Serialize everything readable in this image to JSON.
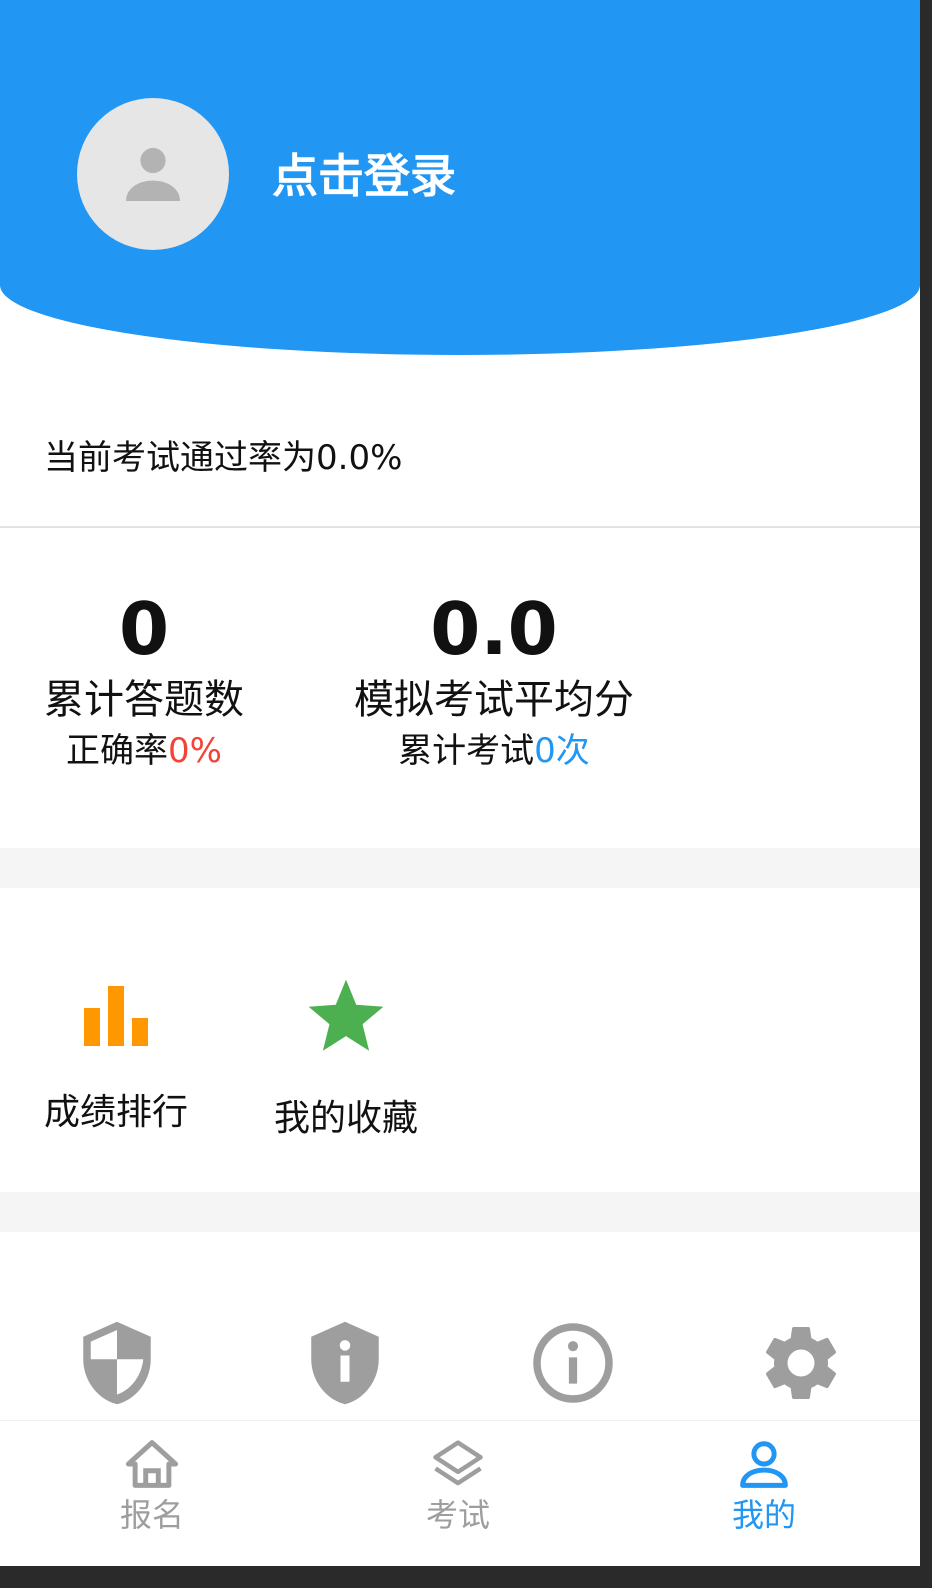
{
  "header": {
    "login_label": "点击登录",
    "background_color": "#2196f3",
    "avatar_icon": "person-icon"
  },
  "pass_rate": {
    "label": "当前考试通过率为0.0%"
  },
  "stats": {
    "answers": {
      "value": "0",
      "label": "累计答题数",
      "sub_prefix": "正确率",
      "sub_value": "0%",
      "sub_value_color": "#f44336"
    },
    "exams": {
      "value": "0.0",
      "label": "模拟考试平均分",
      "sub_prefix": "累计考试",
      "sub_value": "0次",
      "sub_value_color": "#2196f3"
    }
  },
  "tools": [
    {
      "label": "成绩排行",
      "icon": "bar-chart-icon",
      "color": "#ff9800"
    },
    {
      "label": "我的收藏",
      "icon": "star-icon",
      "color": "#4caf50"
    }
  ],
  "icon_row": [
    {
      "icon": "privacy-shield-icon"
    },
    {
      "icon": "info-shield-icon"
    },
    {
      "icon": "info-circle-icon"
    },
    {
      "icon": "gear-icon"
    }
  ],
  "bottom_nav": {
    "items": [
      {
        "label": "报名",
        "icon": "home-icon",
        "active": false
      },
      {
        "label": "考试",
        "icon": "layers-icon",
        "active": false
      },
      {
        "label": "我的",
        "icon": "user-icon",
        "active": true
      }
    ],
    "active_color": "#2196f3",
    "inactive_color": "#9e9e9e"
  }
}
